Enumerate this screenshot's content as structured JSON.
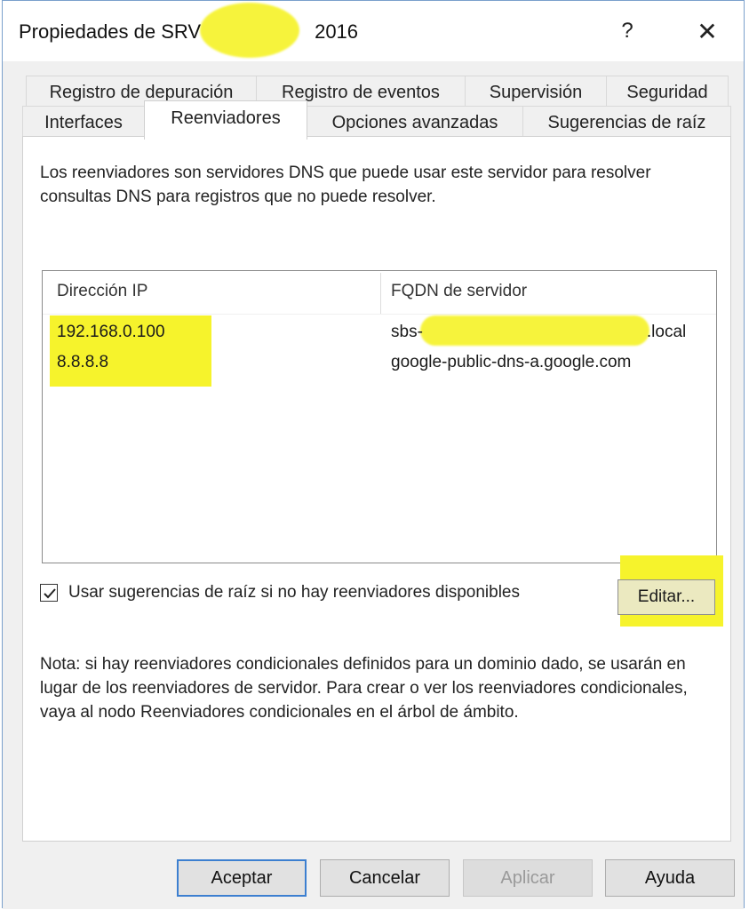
{
  "window": {
    "title_prefix": "Propiedades de SRV",
    "title_suffix": "2016",
    "help_glyph": "?",
    "close_glyph": "✕",
    "redaction_color": "#f6f32c"
  },
  "tabs": {
    "row1": [
      "Registro de depuración",
      "Registro de eventos",
      "Supervisión",
      "Seguridad"
    ],
    "row2": [
      "Interfaces",
      "Reenviadores",
      "Opciones avanzadas",
      "Sugerencias de raíz"
    ],
    "active": "Reenviadores"
  },
  "description": "Los reenviadores son servidores DNS que puede usar este servidor para resolver consultas DNS para registros que no puede resolver.",
  "forwarders": {
    "columns": [
      "Dirección IP",
      "FQDN de servidor"
    ],
    "rows": [
      {
        "ip": "192.168.0.100",
        "fqdn_prefix": "sbs-",
        "fqdn_suffix": ".local"
      },
      {
        "ip": "8.8.8.8",
        "fqdn": "google-public-dns-a.google.com"
      }
    ]
  },
  "root_hints": {
    "checked": true,
    "label": "Usar sugerencias de raíz si no hay reenviadores disponibles"
  },
  "edit_button": "Editar...",
  "note": "Nota: si hay reenviadores condicionales definidos para un dominio dado, se usarán en lugar de los reenviadores de servidor. Para crear o ver los reenviadores condicionales, vaya al nodo Reenviadores condicionales en el árbol de ámbito.",
  "buttons": {
    "ok": "Aceptar",
    "cancel": "Cancelar",
    "apply": "Aplicar",
    "help": "Ayuda"
  },
  "icons": {
    "help": "question-mark-icon",
    "close": "close-icon",
    "checkbox": "checkmark-icon"
  }
}
